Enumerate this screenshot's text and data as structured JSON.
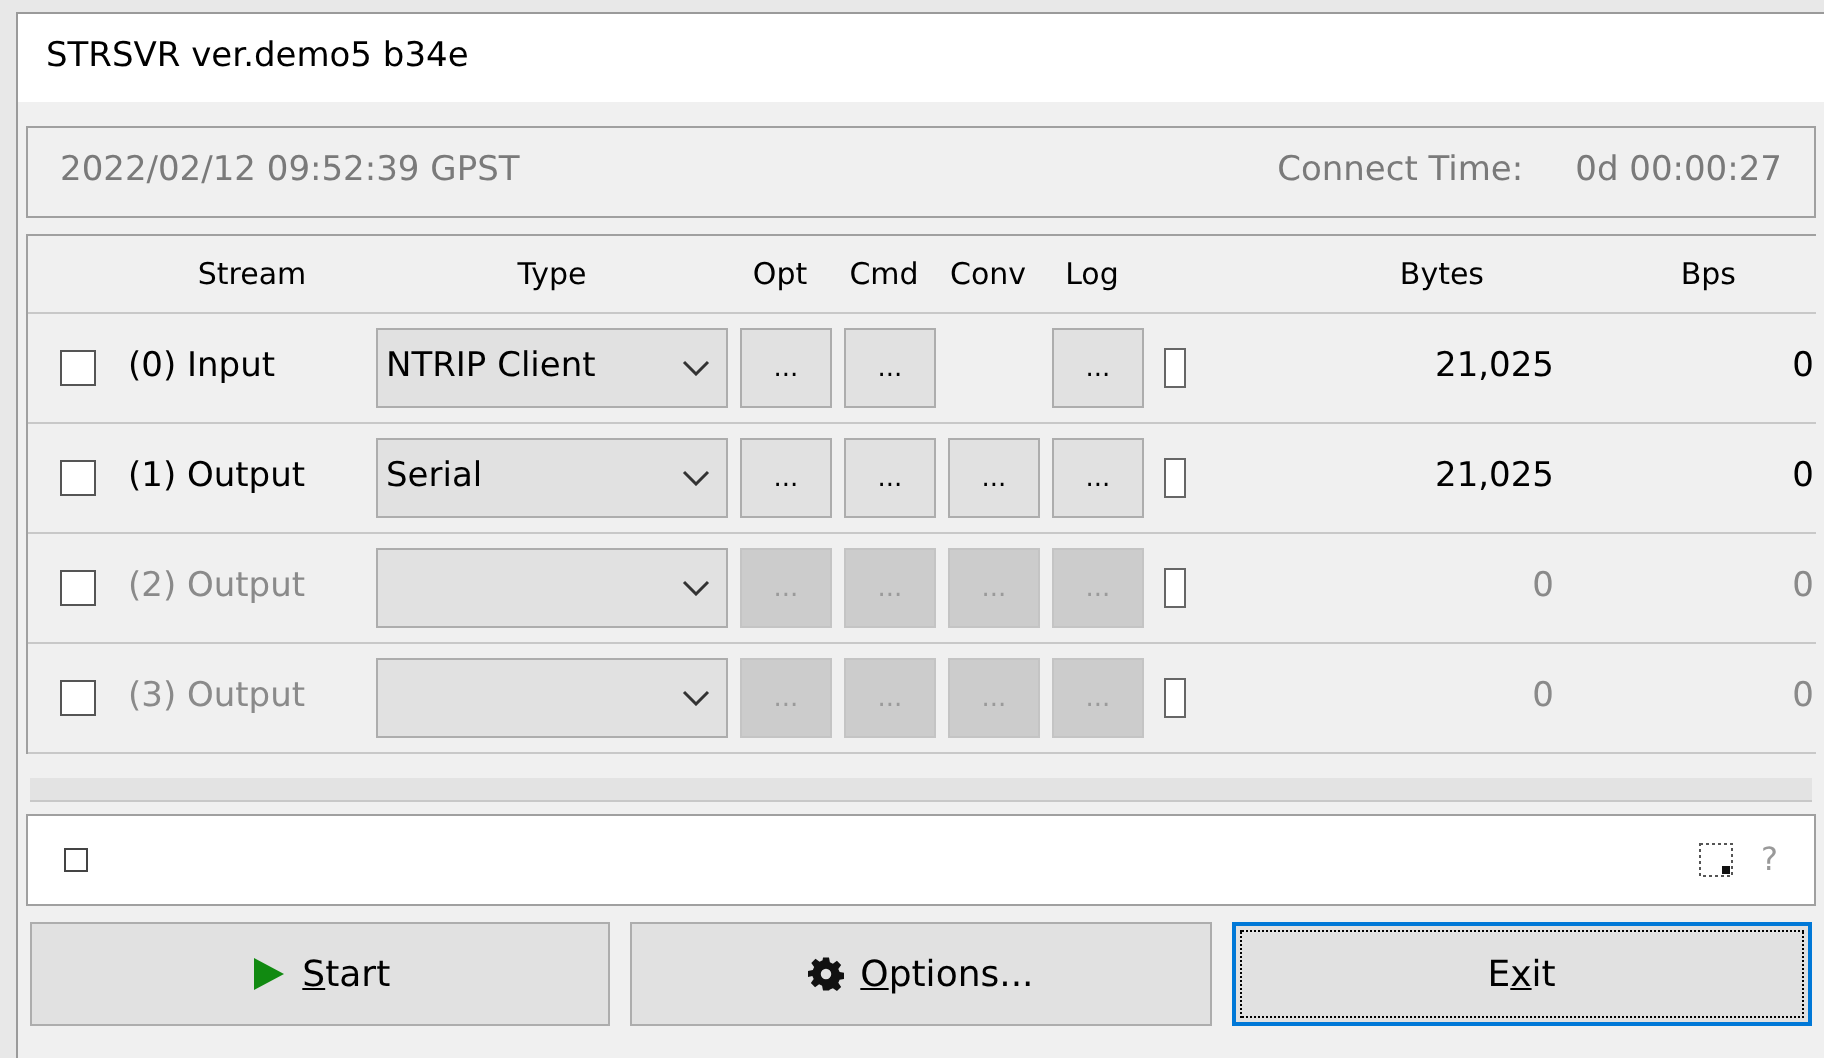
{
  "window": {
    "title": "STRSVR ver.demo5 b34e"
  },
  "time_panel": {
    "time": "2022/02/12 09:52:39 GPST",
    "connect_label": "Connect Time:",
    "connect_value": "0d 00:00:27"
  },
  "table": {
    "columns": [
      "Stream",
      "Type",
      "Opt",
      "Cmd",
      "Conv",
      "Log",
      "Bytes",
      "Bps"
    ],
    "rows": [
      {
        "checked": false,
        "disabled": false,
        "stream": "(0) Input",
        "type": "NTRIP Client",
        "opt": "...",
        "cmd": "...",
        "log": "...",
        "bytes": "21,025",
        "bps": "0"
      },
      {
        "checked": false,
        "disabled": false,
        "stream": "(1) Output",
        "type": "Serial",
        "opt": "...",
        "cmd": "...",
        "conv": "...",
        "log": "...",
        "bytes": "21,025",
        "bps": "0"
      },
      {
        "checked": false,
        "disabled": true,
        "stream": "(2) Output",
        "opt": "...",
        "cmd": "...",
        "conv": "...",
        "log": "...",
        "bytes": "0",
        "bps": "0"
      },
      {
        "checked": false,
        "disabled": true,
        "stream": "(3) Output",
        "opt": "...",
        "cmd": "...",
        "conv": "...",
        "log": "...",
        "bytes": "0",
        "bps": "0"
      }
    ]
  },
  "status_bar": {
    "help": "?"
  },
  "buttons": [
    {
      "kind": "start",
      "hotkey": "S",
      "after": "tart",
      "focused": false
    },
    {
      "kind": "options",
      "hotkey": "O",
      "after": "ptions...",
      "focused": false
    },
    {
      "kind": "exit",
      "before": "E",
      "hotkey": "x",
      "after": "it",
      "focused": true
    }
  ]
}
